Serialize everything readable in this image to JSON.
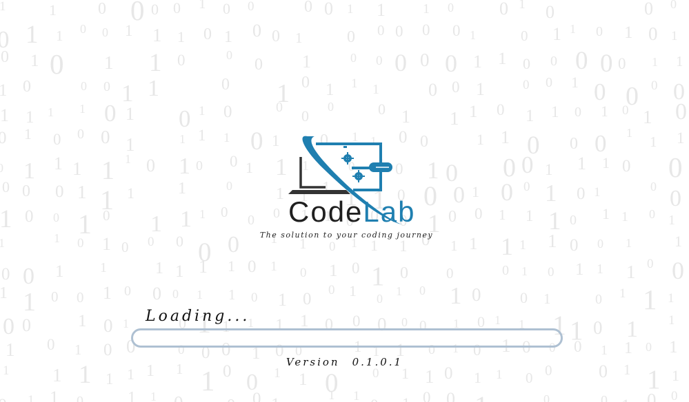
{
  "app": {
    "logo_word_part1": "Code",
    "logo_word_part2": "Lab",
    "tagline": "The solution to your coding journey"
  },
  "loader": {
    "label": "Loading...",
    "progress": 0,
    "version_label": "Version",
    "version_number": "0.1.0.1"
  },
  "icons": {
    "logo": "laptop-with-gears-and-screwdriver-icon"
  },
  "colors": {
    "brand_blue": "#1f7fb0",
    "brand_dark": "#1f1f1f",
    "progress_border": "#aec0d2",
    "background_digits": "#e7e7e7"
  }
}
